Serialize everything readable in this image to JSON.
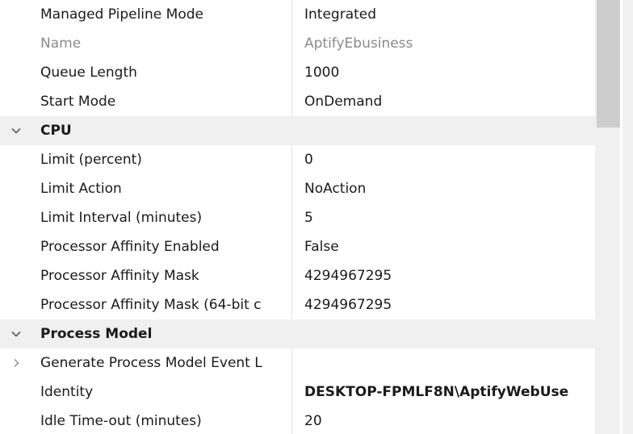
{
  "property_grid": {
    "rows": [
      {
        "name": "Managed Pipeline Mode",
        "value": "Integrated"
      },
      {
        "name": "Name",
        "value": "AptifyEbusiness"
      },
      {
        "name": "Queue Length",
        "value": "1000"
      },
      {
        "name": "Start Mode",
        "value": "OnDemand"
      },
      {
        "category": "CPU",
        "expanded": true
      },
      {
        "name": "Limit (percent)",
        "value": "0"
      },
      {
        "name": "Limit Action",
        "value": "NoAction"
      },
      {
        "name": "Limit Interval (minutes)",
        "value": "5"
      },
      {
        "name": "Processor Affinity Enabled",
        "value": "False"
      },
      {
        "name": "Processor Affinity Mask",
        "value": "4294967295"
      },
      {
        "name": "Processor Affinity Mask (64-bit c",
        "value": "4294967295"
      },
      {
        "category": "Process Model",
        "expanded": true
      },
      {
        "name": "Generate Process Model Event L",
        "value": "",
        "collapsed": true
      },
      {
        "name": "Identity",
        "value": "DESKTOP-FPMLF8N\\AptifyWebUse"
      },
      {
        "name": "Idle Time-out (minutes)",
        "value": "20"
      }
    ]
  },
  "icons": {
    "expanded": "chevron-down-icon",
    "collapsed": "chevron-right-icon"
  },
  "colors": {
    "category_background": "#f0f0f0",
    "disabled_text": "#8a8a8a",
    "scrollbar_track": "#f0f0f0",
    "scrollbar_thumb": "#cdcdcd"
  }
}
